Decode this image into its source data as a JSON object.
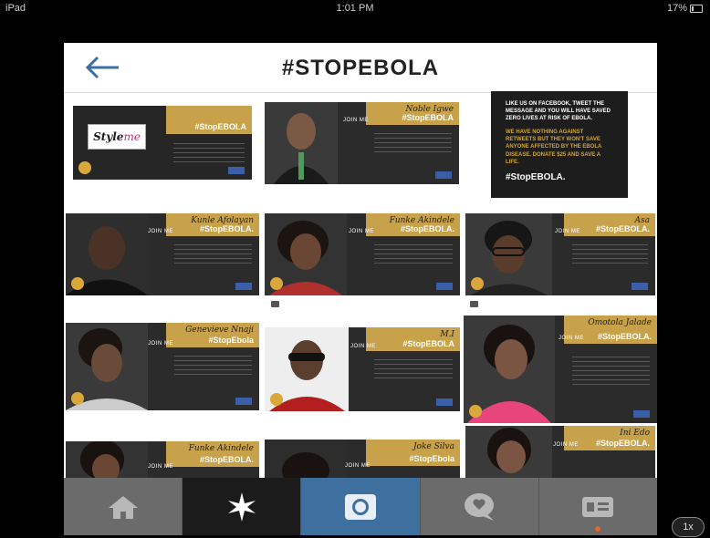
{
  "status_bar": {
    "device": "iPad",
    "time": "1:01 PM",
    "battery": "17%"
  },
  "header": {
    "title": "#STOPEBOLA",
    "back_icon": "arrow-left-icon"
  },
  "posts": [
    {
      "signature": "Style me",
      "hashtag": "#StopEBOLA"
    },
    {
      "signature": "Noble Igwe",
      "join": "JOIN ME",
      "hashtag": "#StopEBOLA"
    },
    {
      "text": "LIKE US ON FACEBOOK, TWEET THE MESSAGE AND YOU WILL HAVE SAVED ZERO LIVES AT RISK OF EBOLA.",
      "text2": "WE HAVE NOTHING AGAINST RETWEETS BUT THEY WON'T SAVE ANYONE AFFECTED BY THE EBOLA DISEASE. DONATE $25 AND SAVE A LIFE.",
      "hashtag": "#StopEBOLA."
    },
    {
      "signature": "Kunle Afolayan",
      "join": "JOIN ME",
      "hashtag": "#StopEBOLA."
    },
    {
      "signature": "Funke Akindele",
      "join": "JOIN ME",
      "hashtag": "#StopEBOLA."
    },
    {
      "signature": "Asa",
      "join": "JOIN ME",
      "hashtag": "#StopEBOLA."
    },
    {
      "signature": "Genevieve Nnaji",
      "join": "JOIN ME",
      "hashtag": "#StopEbola"
    },
    {
      "signature": "M.I",
      "join": "JOIN ME",
      "hashtag": "#StopEBOLA"
    },
    {
      "signature": "Omotola Jalade",
      "join": "JOIN ME",
      "hashtag": "#StopEBOLA."
    },
    {
      "signature": "Funke Akindele",
      "join": "JOIN ME",
      "hashtag": "#StopEBOLA."
    },
    {
      "signature": "Joke Silva",
      "join": "JOIN ME",
      "hashtag": "#StopEbola"
    },
    {
      "signature": "Ini Edo",
      "join": "JOIN ME",
      "hashtag": "#StopEBOLA."
    }
  ],
  "styleme_logo": {
    "part1": "Style",
    "part2": "me"
  },
  "tabbar": {
    "tabs": [
      {
        "name": "home",
        "icon": "home-icon"
      },
      {
        "name": "explore",
        "icon": "star-icon"
      },
      {
        "name": "camera",
        "icon": "camera-icon"
      },
      {
        "name": "news",
        "icon": "heart-bubble-icon"
      },
      {
        "name": "profile",
        "icon": "profile-card-icon"
      }
    ],
    "active": "explore"
  },
  "zoom": "1x",
  "colors": {
    "accent_blue": "#3d6f9f",
    "gold": "#c8a24a",
    "back_arrow": "#3a6ea8"
  }
}
